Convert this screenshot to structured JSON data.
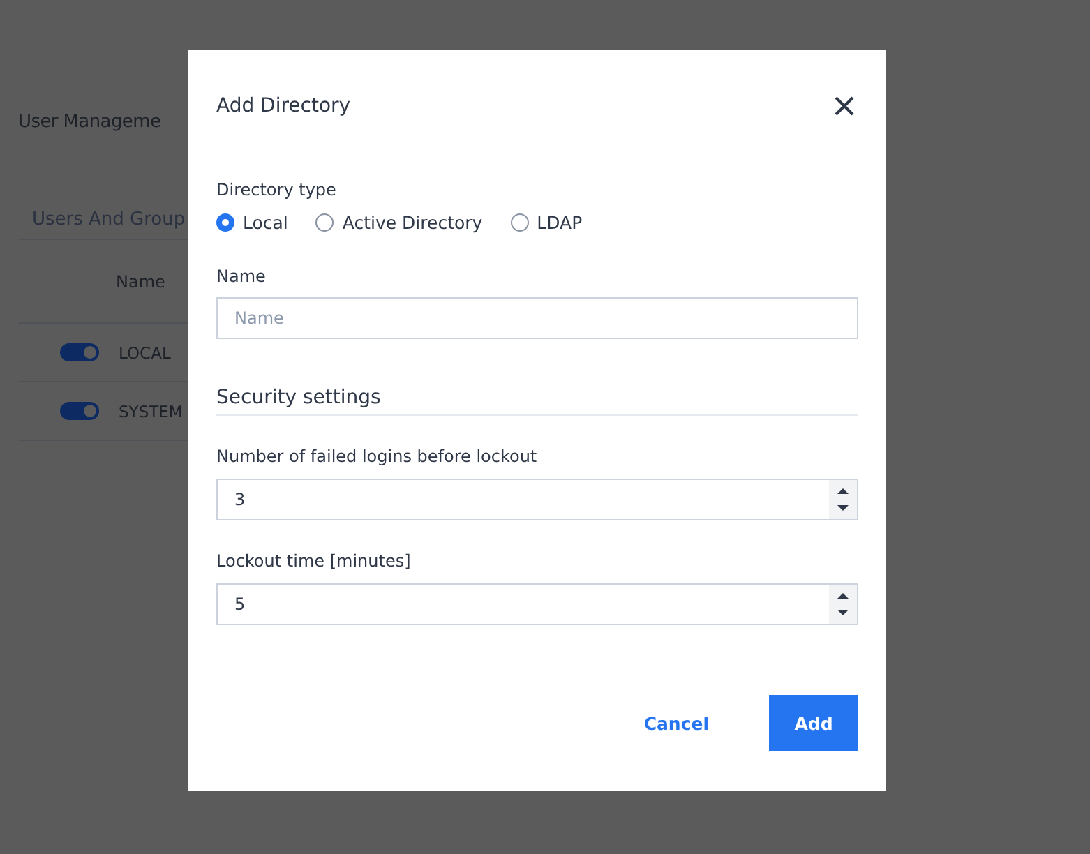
{
  "page": {
    "title": "User Manageme",
    "tab": "Users And Group",
    "table": {
      "columns": [
        "Name"
      ],
      "rows": [
        {
          "name": "LOCAL",
          "enabled": true
        },
        {
          "name": "SYSTEM",
          "enabled": true
        }
      ]
    }
  },
  "dialog": {
    "title": "Add Directory",
    "directory_type": {
      "label": "Directory type",
      "options": [
        {
          "label": "Local",
          "selected": true
        },
        {
          "label": "Active Directory",
          "selected": false
        },
        {
          "label": "LDAP",
          "selected": false
        }
      ]
    },
    "name": {
      "label": "Name",
      "placeholder": "Name"
    },
    "section": "Security settings",
    "number_fields": [
      {
        "label": "Number of failed logins before lockout",
        "value": "3"
      },
      {
        "label": "Lockout time [minutes]",
        "value": "5"
      }
    ],
    "buttons": {
      "cancel": "Cancel",
      "submit": "Add"
    }
  }
}
